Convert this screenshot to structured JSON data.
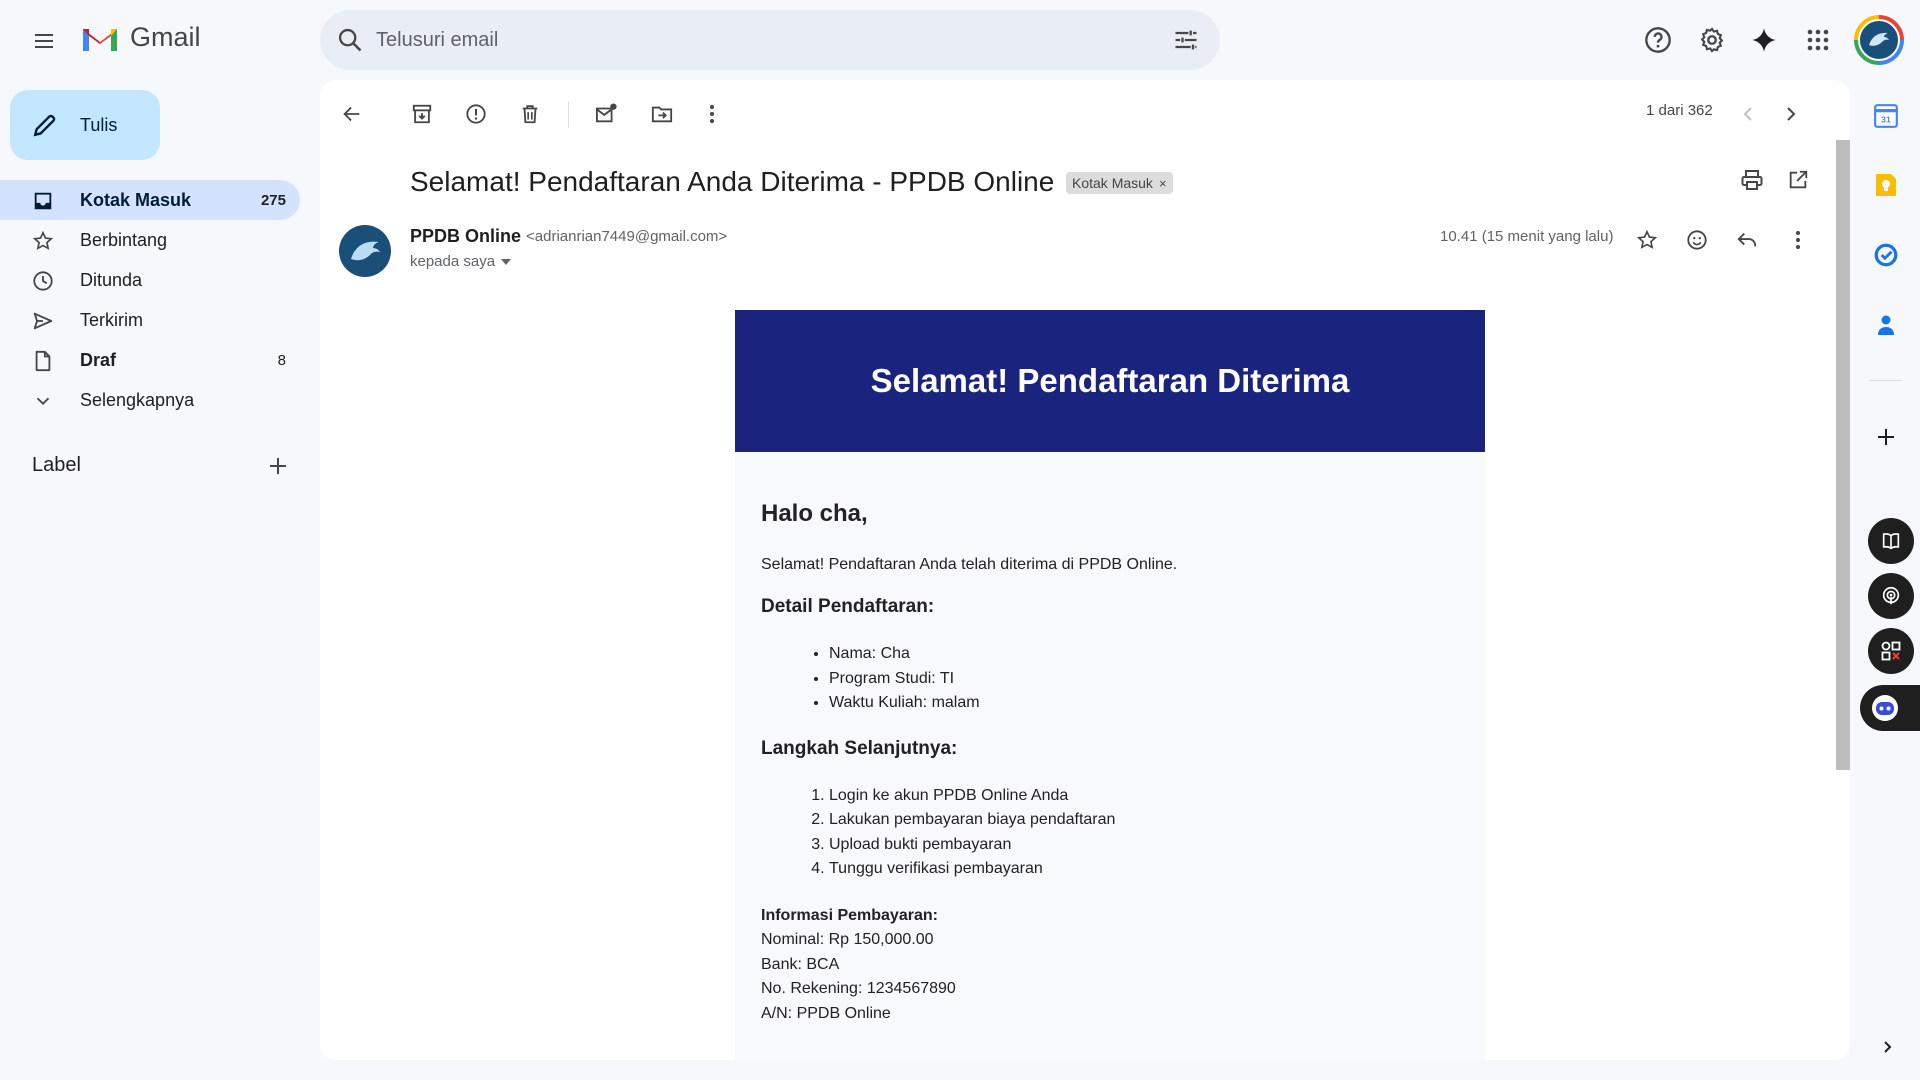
{
  "app": {
    "name": "Gmail"
  },
  "search": {
    "placeholder": "Telusuri email"
  },
  "compose": {
    "label": "Tulis"
  },
  "nav": {
    "items": [
      {
        "label": "Kotak Masuk",
        "count": "275"
      },
      {
        "label": "Berbintang",
        "count": ""
      },
      {
        "label": "Ditunda",
        "count": ""
      },
      {
        "label": "Terkirim",
        "count": ""
      },
      {
        "label": "Draf",
        "count": "8"
      },
      {
        "label": "Selengkapnya",
        "count": ""
      }
    ],
    "labels_heading": "Label"
  },
  "toolbar": {
    "pager": "1 dari 362"
  },
  "message": {
    "subject": "Selamat! Pendaftaran Anda Diterima - PPDB Online",
    "chip": "Kotak Masuk",
    "chip_close": "×",
    "sender_name": "PPDB Online",
    "sender_email": "<adrianrian7449@gmail.com>",
    "to": "kepada saya",
    "time": "10.41 (15 menit yang lalu)"
  },
  "email": {
    "banner": "Selamat! Pendaftaran Diterima",
    "greeting": "Halo cha,",
    "intro": "Selamat! Pendaftaran Anda telah diterima di PPDB Online.",
    "detail_heading": "Detail Pendaftaran:",
    "details": [
      "Nama: Cha",
      "Program Studi: TI",
      "Waktu Kuliah: malam"
    ],
    "next_heading": "Langkah Selanjutnya:",
    "steps": [
      "Login ke akun PPDB Online Anda",
      "Lakukan pembayaran biaya pendaftaran",
      "Upload bukti pembayaran",
      "Tunggu verifikasi pembayaran"
    ],
    "payment_heading": "Informasi Pembayaran:",
    "payment": [
      "Nominal: Rp 150,000.00",
      "Bank: BCA",
      "No. Rekening: 1234567890",
      "A/N: PPDB Online"
    ]
  },
  "colors": {
    "accent": "#c2e7ff",
    "active_nav": "#d3e3fd",
    "banner": "#1a237e"
  },
  "icons": [
    "menu-icon",
    "gmail-logo-icon",
    "search-icon",
    "filter-icon",
    "help-icon",
    "settings-icon",
    "gemini-icon",
    "apps-icon",
    "back-icon",
    "archive-icon",
    "spam-icon",
    "delete-icon",
    "mark-unread-icon",
    "move-icon",
    "more-icon",
    "prev-icon",
    "next-icon",
    "print-icon",
    "open-new-window-icon",
    "star-icon",
    "emoji-icon",
    "reply-icon",
    "calendar-icon",
    "keep-icon",
    "tasks-icon",
    "contacts-icon",
    "add-icon"
  ]
}
